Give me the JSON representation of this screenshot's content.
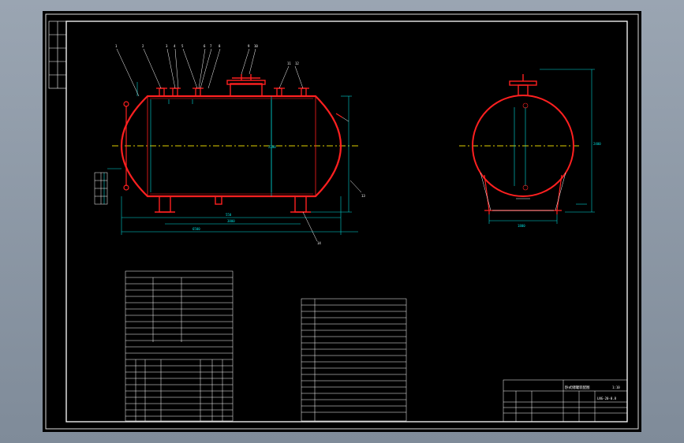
{
  "drawing": {
    "title_text": "卧式储罐装配图",
    "title_sub": "1:10",
    "drawing_number": "LNG-20-0.8",
    "scale": "1:10"
  },
  "colors": {
    "background": "#000000",
    "frame": "#ffffff",
    "vessel": "#ff2020",
    "dimension": "#00e0e0",
    "centerline": "#e0d000"
  },
  "leaders": [
    "1",
    "2",
    "3",
    "4",
    "5",
    "6",
    "7",
    "8",
    "9",
    "10",
    "11",
    "12",
    "13",
    "14"
  ],
  "dimensions": {
    "overall_length": "6500",
    "support_span": "3800",
    "shell_diameter": "2200",
    "end_height": "550",
    "side_width": "2400",
    "support_base": "1800"
  }
}
